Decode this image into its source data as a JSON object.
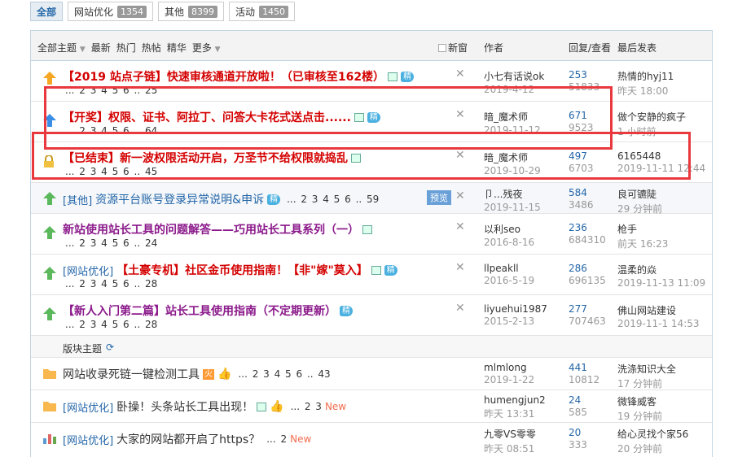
{
  "tabs": [
    {
      "label": "全部",
      "count": ""
    },
    {
      "label": "网站优化",
      "count": "1354"
    },
    {
      "label": "其他",
      "count": "8399"
    },
    {
      "label": "活动",
      "count": "1450"
    }
  ],
  "header": {
    "all_topics": "全部主题",
    "newest": "最新",
    "hot": "热门",
    "hot_posts": "热帖",
    "digest": "精华",
    "more": "更多",
    "new_window": "新窗",
    "author": "作者",
    "reply_view": "回复/查看",
    "last_post": "最后发表"
  },
  "threads": [
    {
      "title": "【2019 站点子链】快速审核通道开放啦！（已审核至162楼）",
      "jing": "精",
      "pages": "... 2 3 4 5 6 .. 25",
      "author": "小七有话说ok",
      "date": "2019-4-12",
      "replies": "253",
      "views": "51833",
      "last_user": "热情的hyj11",
      "last_time": "昨天 18:00"
    },
    {
      "title": "【开奖】权限、证书、阿拉丁、问答大卡花式送点击......",
      "jing": "精",
      "pages": "... 2 3 4 5 6 .. 64",
      "author": "暗_魔术师",
      "date": "2019-11-12",
      "replies": "671",
      "views": "9523",
      "last_user": "做个安静的疯子",
      "last_time": "1 小时前"
    },
    {
      "title": "【已结束】新一波权限活动开启，万圣节不给权限就捣乱",
      "pages": "... 2 3 4 5 6 .. 45",
      "author": "暗_魔术师",
      "date": "2019-10-29",
      "replies": "497",
      "views": "6703",
      "last_user": "6165448",
      "last_time": "2019-11-11 12:44"
    },
    {
      "category": "[其他]",
      "title": "资源平台账号登录异常说明&申诉",
      "jing": "精",
      "pages": "... 2 3 4 5 6 .. 59",
      "preview": "预览",
      "author": "卩...残夜",
      "date": "2019-11-15",
      "replies": "584",
      "views": "3486",
      "last_user": "良可镳陡",
      "last_time": "29 分钟前"
    },
    {
      "title": "新站使用站长工具的问题解答——巧用站长工具系列（一）",
      "pages": "... 2 3 4 5 6 .. 24",
      "author": "以利seo",
      "date": "2016-8-16",
      "replies": "236",
      "views": "684310",
      "last_user": "枪手",
      "last_time": "前天 16:23"
    },
    {
      "category": "[网站优化]",
      "title": "【土豪专机】社区金币使用指南！【非\"嫁\"莫入】",
      "jing": "精",
      "pages": "... 2 3 4 5 6 .. 28",
      "author": "llpeakll",
      "date": "2016-5-19",
      "replies": "286",
      "views": "696135",
      "last_user": "温柔的焱",
      "last_time": "2019-11-13 11:09"
    },
    {
      "title": "【新人入门第二篇】站长工具使用指南（不定期更新）",
      "jing": "精",
      "pages": "... 2 3 4 5 6 .. 28",
      "author": "liyuehui1987",
      "date": "2015-2-13",
      "replies": "277",
      "views": "707463",
      "last_user": "佛山网站建设",
      "last_time": "2019-11-1 14:53"
    }
  ],
  "section_label": "版块主题",
  "normal_threads": [
    {
      "title": "网站收录死链一键检测工具",
      "hot": "火",
      "pages": "... 2 3 4 5 6 .. 43",
      "author": "mlmlong",
      "date": "2019-1-22",
      "replies": "441",
      "views": "10812",
      "last_user": "洗涤知识大全",
      "last_time": "17 分钟前"
    },
    {
      "category": "[网站优化]",
      "title": "卧操！头条站长工具出现！",
      "pages": "... 2 3",
      "new": "New",
      "author": "humengjun2",
      "date": "昨天 13:31",
      "replies": "24",
      "views": "585",
      "last_user": "微锋威客",
      "last_time": "19 分钟前"
    },
    {
      "category": "[网站优化]",
      "title": "大家的网站都开启了https？",
      "pages": "... 2",
      "new": "New",
      "author": "九零VS零零",
      "date": "昨天 08:51",
      "replies": "20",
      "views": "333",
      "last_user": "给心灵找个家56",
      "last_time": "20 分钟前"
    }
  ],
  "colors": {
    "highlight_box": "#e8393f",
    "link": "#2366a8",
    "title_red": "#d40000",
    "title_purple": "#8b1a8b"
  }
}
